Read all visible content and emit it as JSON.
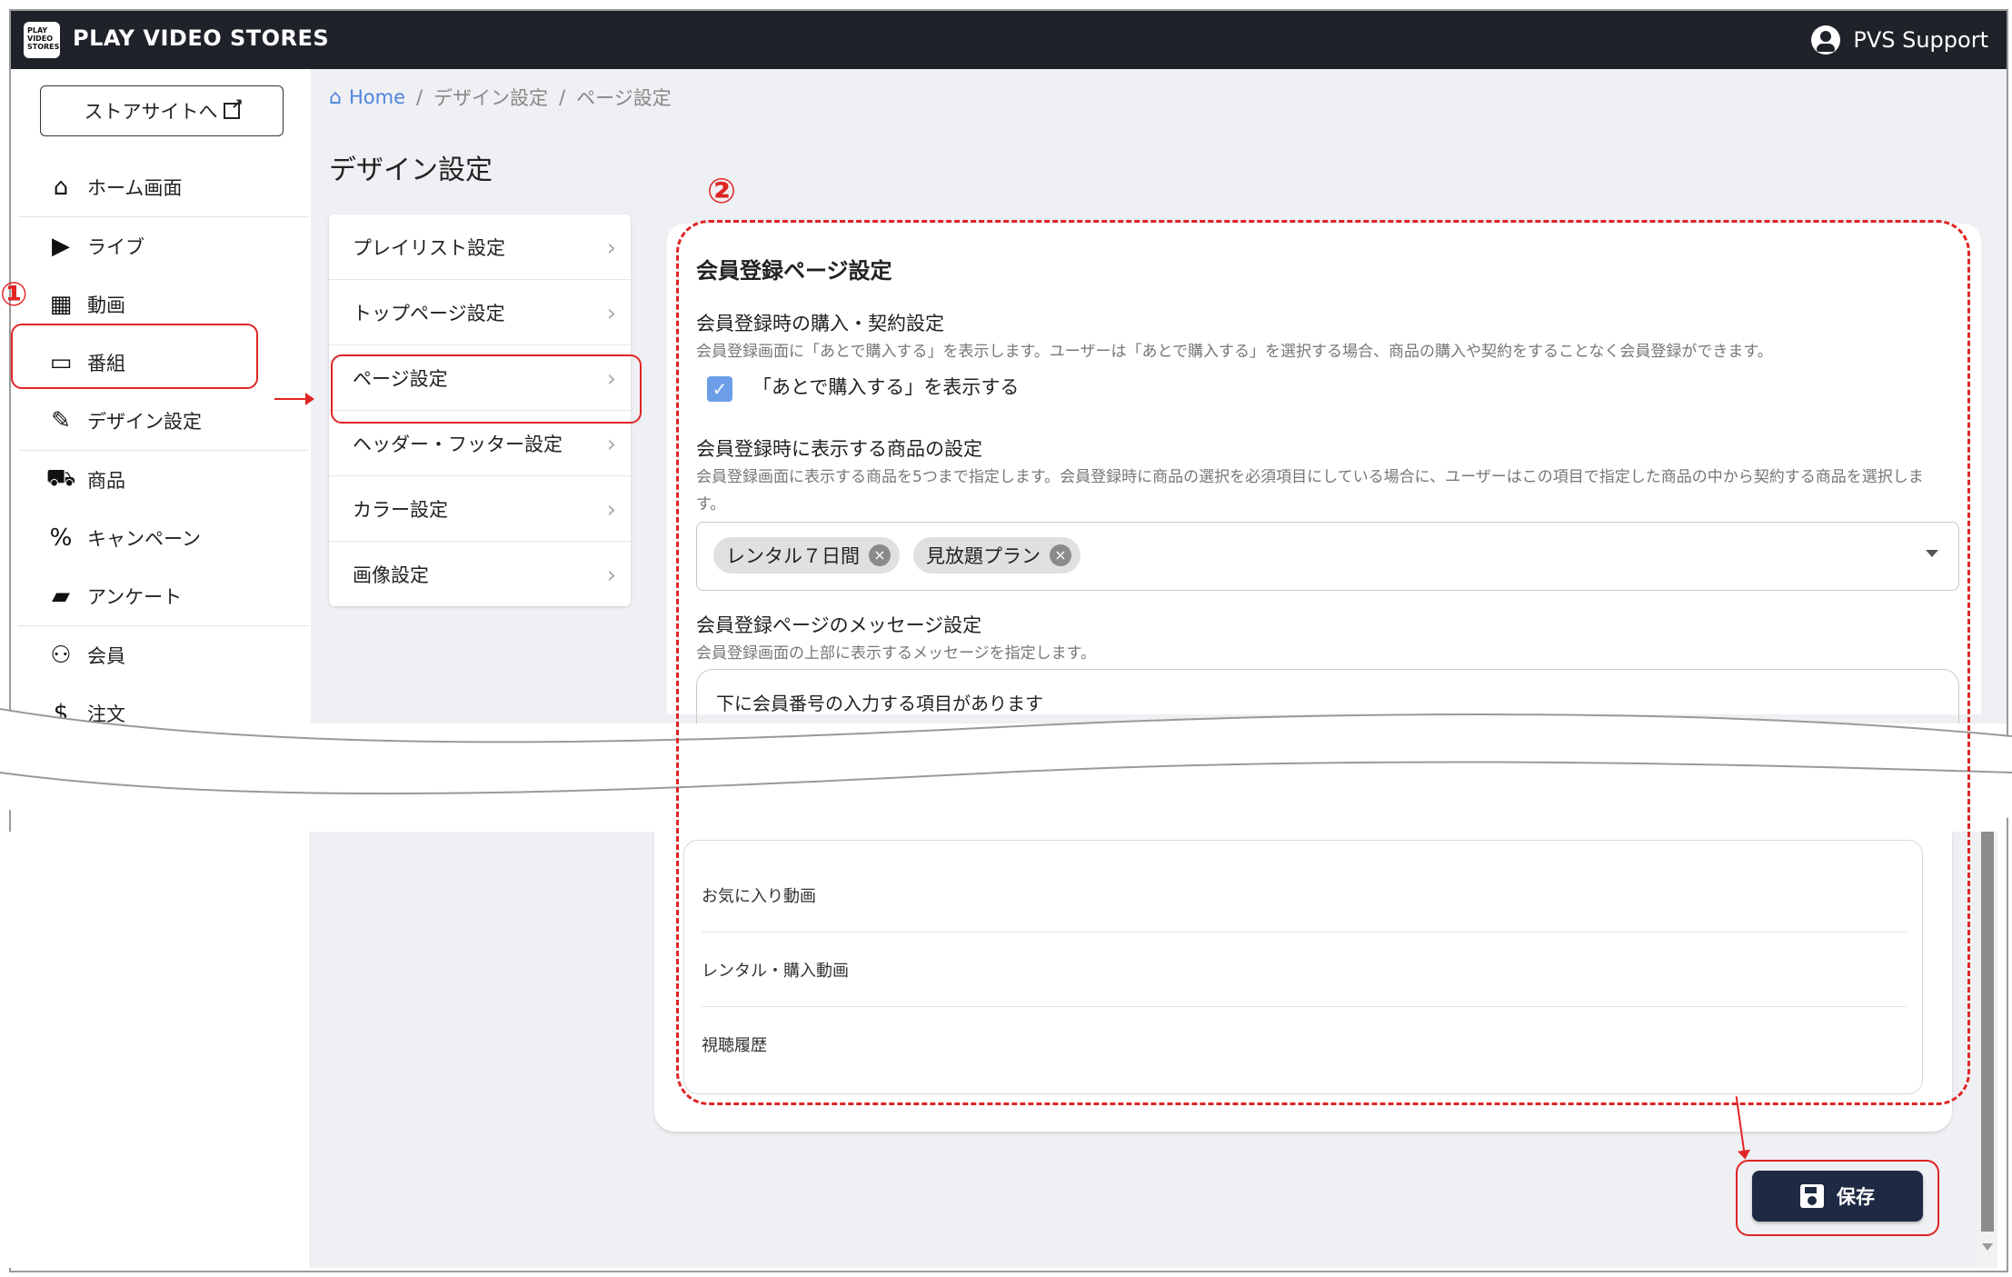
{
  "header": {
    "logo_text": "PLAY VIDEO STORES",
    "brand": "PLAY VIDEO STORES",
    "user": "PVS Support"
  },
  "sidebar": {
    "store_button": "ストアサイトへ",
    "items": [
      {
        "label": "ホーム画面",
        "icon": "home-icon"
      },
      {
        "label": "ライブ",
        "icon": "video-camera-icon"
      },
      {
        "label": "動画",
        "icon": "clapper-icon"
      },
      {
        "label": "番組",
        "icon": "tv-icon"
      },
      {
        "label": "デザイン設定",
        "icon": "brush-icon"
      },
      {
        "label": "商品",
        "icon": "cart-icon"
      },
      {
        "label": "キャンペーン",
        "icon": "percent-icon"
      },
      {
        "label": "アンケート",
        "icon": "chat-icon"
      },
      {
        "label": "会員",
        "icon": "people-icon"
      },
      {
        "label": "注文",
        "icon": "dollar-icon"
      }
    ]
  },
  "breadcrumb": {
    "home": "Home",
    "sep": "/",
    "level1": "デザイン設定",
    "level2": "ページ設定"
  },
  "page_title": "デザイン設定",
  "submenu": [
    "プレイリスト設定",
    "トップページ設定",
    "ページ設定",
    "ヘッダー・フッター設定",
    "カラー設定",
    "画像設定"
  ],
  "card": {
    "title": "会員登録ページ設定",
    "purchase": {
      "title": "会員登録時の購入・契約設定",
      "desc": "会員登録画面に「あとで購入する」を表示します。ユーザーは「あとで購入する」を選択する場合、商品の購入や契約をすることなく会員登録ができます。",
      "checkbox_label": "「あとで購入する」を表示する",
      "checked": true
    },
    "products": {
      "title": "会員登録時に表示する商品の設定",
      "desc": "会員登録画面に表示する商品を5つまで指定します。会員登録時に商品の選択を必須項目にしている場合に、ユーザーはこの項目で指定した商品の中から契約する商品を選択します。",
      "chips": [
        "レンタル７日間",
        "見放題プラン"
      ]
    },
    "message": {
      "title": "会員登録ページのメッセージ設定",
      "desc": "会員登録画面の上部に表示するメッセージを指定します。",
      "value": "下に会員番号の入力する項目があります"
    },
    "list": [
      "お気に入り動画",
      "レンタル・購入動画",
      "視聴履歴"
    ]
  },
  "save_button": "保存",
  "annotations": {
    "num1": "①",
    "num2": "②"
  },
  "colors": {
    "accent_red": "#e02424",
    "header_bg": "#1f2329",
    "save_bg": "#1e2a44",
    "link_blue": "#4e84e0"
  }
}
